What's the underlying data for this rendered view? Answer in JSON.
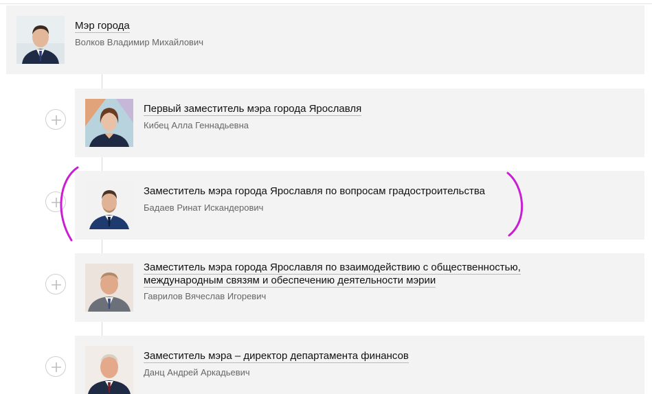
{
  "mayor": {
    "title": "Мэр города",
    "name": "Волков Владимир Михайлович"
  },
  "deputies": [
    {
      "title": "Первый заместитель мэра города Ярославля",
      "name": "Кибец Алла Геннадьевна",
      "linked": true
    },
    {
      "title": "Заместитель мэра города Ярославля по вопросам градостроительства",
      "name": "Бадаев Ринат Искандерович",
      "linked": false,
      "highlighted": true
    },
    {
      "title": "Заместитель мэра города Ярославля по взаимодействию с общественностью, международным связям и обеспечению деятельности мэрии",
      "title_line1": "Заместитель мэра города Ярославля по взаимодействию с общественностью,",
      "title_line2": "международным связям и обеспечению деятельности мэрии",
      "name": "Гаврилов Вячеслав Игоревич",
      "linked": true
    },
    {
      "title": "Заместитель мэра – директор департамента финансов",
      "name": "Данц Андрей Аркадьевич",
      "linked": true
    }
  ],
  "icons": {
    "expand": "plus-circle-icon"
  },
  "colors": {
    "card_bg": "#f3f3f3",
    "annotation": "#c81fd2",
    "suit": "#1f2a44"
  }
}
